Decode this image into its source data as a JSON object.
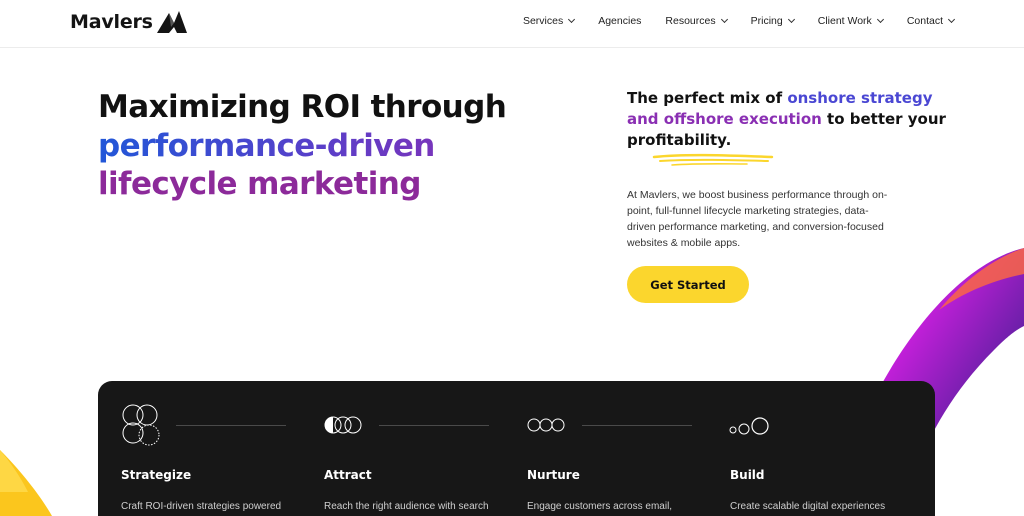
{
  "brand": {
    "name": "Mavlers",
    "logo_icon": "mavlers-logo-icon"
  },
  "nav": {
    "items": [
      {
        "label": "Services",
        "has_dropdown": true
      },
      {
        "label": "Agencies",
        "has_dropdown": false
      },
      {
        "label": "Resources",
        "has_dropdown": true
      },
      {
        "label": "Pricing",
        "has_dropdown": true
      },
      {
        "label": "Client Work",
        "has_dropdown": true
      },
      {
        "label": "Contact",
        "has_dropdown": true
      }
    ]
  },
  "hero": {
    "title_line1": "Maximizing ROI through",
    "title_line2": "performance-driven",
    "title_line3": "lifecycle marketing",
    "tagline_pre": "The perfect mix of ",
    "tagline_hl1": "onshore strategy",
    "tagline_hl2": "and offshore execution",
    "tagline_post": " to better your profitability.",
    "description": "At Mavlers, we boost business performance through on-point, full-funnel lifecycle marketing strategies, data-driven performance marketing, and conversion-focused websites & mobile apps.",
    "cta_label": "Get Started"
  },
  "colors": {
    "accent_yellow": "#fbd62d",
    "accent_blue": "#2157d8",
    "accent_purple": "#8a2fb3",
    "panel_bg": "#171717"
  },
  "stages": [
    {
      "title": "Strategize",
      "text": "Craft ROI-driven strategies powered",
      "icon": "four-circles-icon"
    },
    {
      "title": "Attract",
      "text": "Reach the right audience with search",
      "icon": "overlapping-circles-icon"
    },
    {
      "title": "Nurture",
      "text": "Engage customers across email,",
      "icon": "three-circles-icon"
    },
    {
      "title": "Build",
      "text": "Create scalable digital experiences",
      "icon": "growing-circles-icon"
    }
  ]
}
